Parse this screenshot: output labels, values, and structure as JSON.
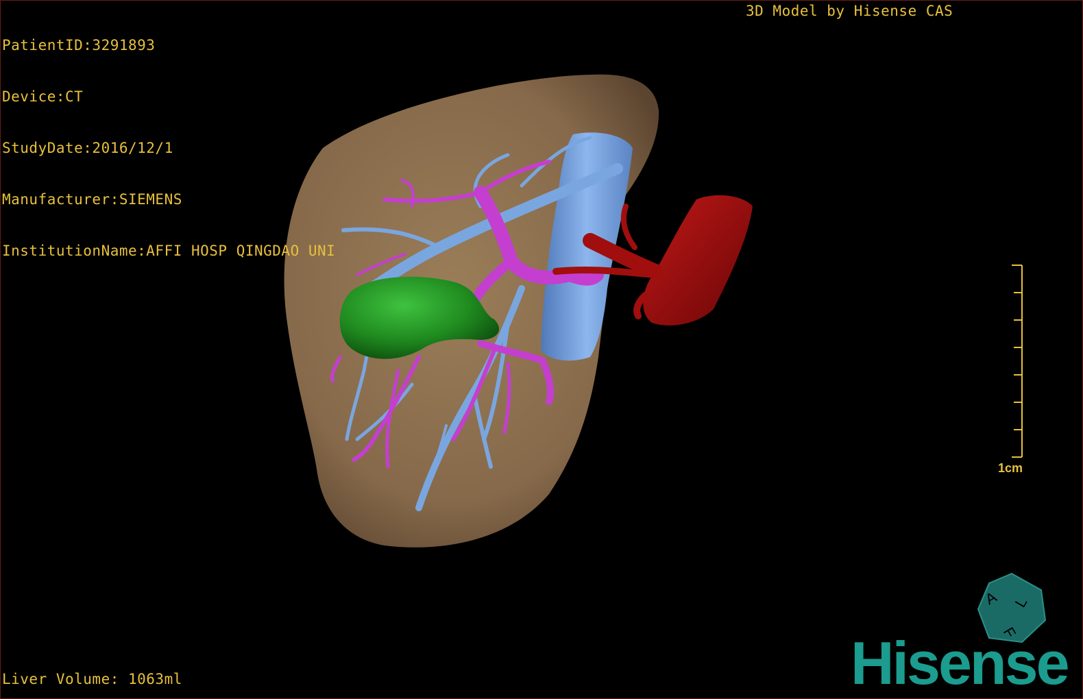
{
  "patient_info": {
    "patient_id": "PatientID:3291893",
    "device": "Device:CT",
    "study_date": "StudyDate:2016/12/1",
    "manufacturer": "Manufacturer:SIEMENS",
    "institution": "InstitutionName:AFFI HOSP QINGDAO UNI"
  },
  "model_credit": "3D Model by Hisense CAS",
  "liver_volume": "Liver Volume: 1063ml",
  "scale_bar": {
    "label": "1cm"
  },
  "orientation_cube": {
    "letters": [
      "A",
      "F",
      "L"
    ],
    "color": "#1a6b66"
  },
  "brand": {
    "name": "Hisense",
    "color": "#1b9c8e"
  },
  "colors": {
    "text_overlay": "#e8c13c",
    "liver": "#8b7050",
    "portal_vein": "#7aa6e0",
    "hepatic_artery_branches": "#c43fcf",
    "gallbladder": "#1f8a1f",
    "aorta": "#a10e0e"
  }
}
